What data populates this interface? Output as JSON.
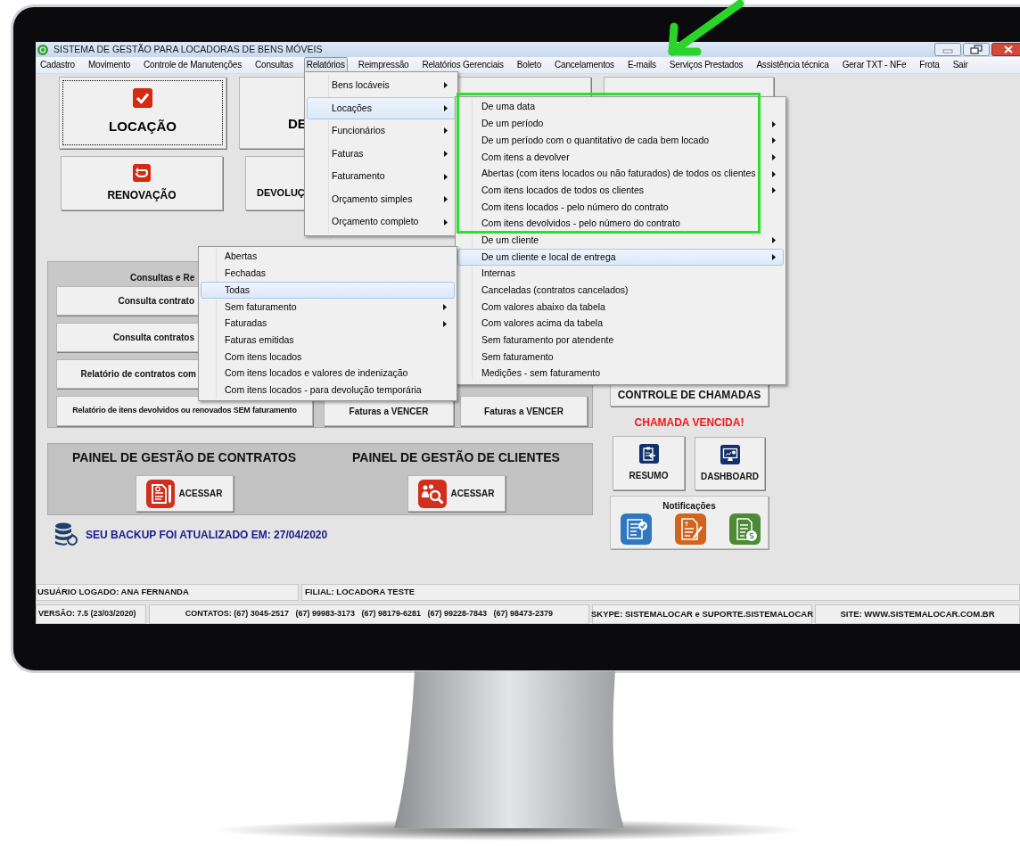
{
  "window": {
    "title": "SISTEMA DE GESTÃO PARA LOCADORAS DE BENS MÓVEIS"
  },
  "menu_bar": [
    {
      "label": "Cadastro",
      "selected": false
    },
    {
      "label": "Movimento",
      "selected": false
    },
    {
      "label": "Controle de Manutenções",
      "selected": false
    },
    {
      "label": "Consultas",
      "selected": false
    },
    {
      "label": "Relatórios",
      "selected": true
    },
    {
      "label": "Reimpressão",
      "selected": false
    },
    {
      "label": "Relatórios Gerenciais",
      "selected": false
    },
    {
      "label": "Boleto",
      "selected": false
    },
    {
      "label": "Cancelamentos",
      "selected": false
    },
    {
      "label": "E-mails",
      "selected": false
    },
    {
      "label": "Serviços Prestados",
      "selected": false
    },
    {
      "label": "Assistência técnica",
      "selected": false
    },
    {
      "label": "Gerar TXT - NFe",
      "selected": false
    },
    {
      "label": "Frota",
      "selected": false
    },
    {
      "label": "Sair",
      "selected": false
    }
  ],
  "main_buttons": [
    {
      "label": "LOCAÇÃO",
      "focused": true
    },
    {
      "label": "DE",
      "focused": false
    },
    {
      "label": "RENOVAÇÃO",
      "focused": false
    },
    {
      "label": "DEVOLUÇ",
      "focused": false
    }
  ],
  "consultas_panel": {
    "title": "Consultas e Re",
    "buttons": [
      "Consulta contrato",
      "Consulta contratos",
      "Relatório de contratos com",
      "Relatório de itens devolvidos ou renovados SEM faturamento",
      "Faturas a VENCER",
      "Faturas a VENCER"
    ]
  },
  "panels": [
    {
      "title": "PAINEL DE GESTÃO DE CONTRATOS",
      "button": "ACESSAR"
    },
    {
      "title": "PAINEL DE GESTÃO DE CLIENTES",
      "button": "ACESSAR"
    }
  ],
  "backup_notice": "SEU BACKUP FOI ATUALIZADO EM: 27/04/2020",
  "calls_button": "CONTROLE DE CHAMADAS",
  "calls_alert": "CHAMADA VENCIDA!",
  "shortcuts": [
    "RESUMO",
    "DASHBOARD"
  ],
  "notifications": {
    "title": "Notificações"
  },
  "status_bar": {
    "user": "USUÁRIO LOGADO: ANA FERNANDA",
    "branch": "FILIAL: LOCADORA TESTE",
    "version": "VERSÃO: 7.5 (23/03/2020)",
    "contacts": "CONTATOS: (67) 3045-2517   (67) 99983-3173   (67) 98179-6281   (67) 99228-7843   (67) 98473-2379",
    "skype": "SKYPE: SISTEMALOCAR e SUPORTE.SISTEMALOCAR",
    "site": "SITE: WWW.SISTEMALOCAR.COM.BR"
  },
  "reports_menu": [
    {
      "label": "Bens locáveis",
      "selected": false,
      "submenu": true
    },
    {
      "label": "Locações",
      "selected": true,
      "submenu": true
    },
    {
      "label": "Funcionários",
      "selected": false,
      "submenu": true
    },
    {
      "label": "Faturas",
      "selected": false,
      "submenu": true
    },
    {
      "label": "Faturamento",
      "selected": false,
      "submenu": true
    },
    {
      "label": "Orçamento simples",
      "selected": false,
      "submenu": true
    },
    {
      "label": "Orçamento completo",
      "selected": false,
      "submenu": true
    }
  ],
  "rentals_submenu": [
    {
      "label": "De uma data",
      "selected": false,
      "submenu": false
    },
    {
      "label": "De um período",
      "selected": false,
      "submenu": true
    },
    {
      "label": "De um período com o quantitativo de cada bem locado",
      "selected": false,
      "submenu": true
    },
    {
      "label": "Com itens a devolver",
      "selected": false,
      "submenu": true
    },
    {
      "label": "Abertas (com itens locados ou não faturados) de todos os clientes",
      "selected": false,
      "submenu": true
    },
    {
      "label": "Com itens locados de todos os clientes",
      "selected": false,
      "submenu": true
    },
    {
      "label": "Com itens locados - pelo número do contrato",
      "selected": false,
      "submenu": false
    },
    {
      "label": "Com itens devolvidos - pelo número do contrato",
      "selected": false,
      "submenu": false
    },
    {
      "label": "De um cliente",
      "selected": false,
      "submenu": true
    },
    {
      "label": "De um cliente e local de entrega",
      "selected": true,
      "submenu": true
    },
    {
      "label": "Internas",
      "selected": false,
      "submenu": false
    },
    {
      "label": "Canceladas (contratos cancelados)",
      "selected": false,
      "submenu": false
    },
    {
      "label": "Com valores abaixo da tabela",
      "selected": false,
      "submenu": false
    },
    {
      "label": "Com valores acima da tabela",
      "selected": false,
      "submenu": false
    },
    {
      "label": "Sem faturamento por atendente",
      "selected": false,
      "submenu": false
    },
    {
      "label": "Sem faturamento",
      "selected": false,
      "submenu": false
    },
    {
      "label": "Medições - sem faturamento",
      "selected": false,
      "submenu": false
    }
  ],
  "contracts_submenu": [
    {
      "label": "Abertas",
      "selected": false,
      "submenu": false
    },
    {
      "label": "Fechadas",
      "selected": false,
      "submenu": false
    },
    {
      "label": "Todas",
      "selected": true,
      "submenu": false
    },
    {
      "label": "Sem faturamento",
      "selected": false,
      "submenu": true
    },
    {
      "label": "Faturadas",
      "selected": false,
      "submenu": true
    },
    {
      "label": "Faturas emitidas",
      "selected": false,
      "submenu": false
    },
    {
      "label": "Com itens locados",
      "selected": false,
      "submenu": false
    },
    {
      "label": "Com itens locados e valores de indenização",
      "selected": false,
      "submenu": false
    },
    {
      "label": "Com itens locados - para devolução temporária",
      "selected": false,
      "submenu": false
    }
  ]
}
